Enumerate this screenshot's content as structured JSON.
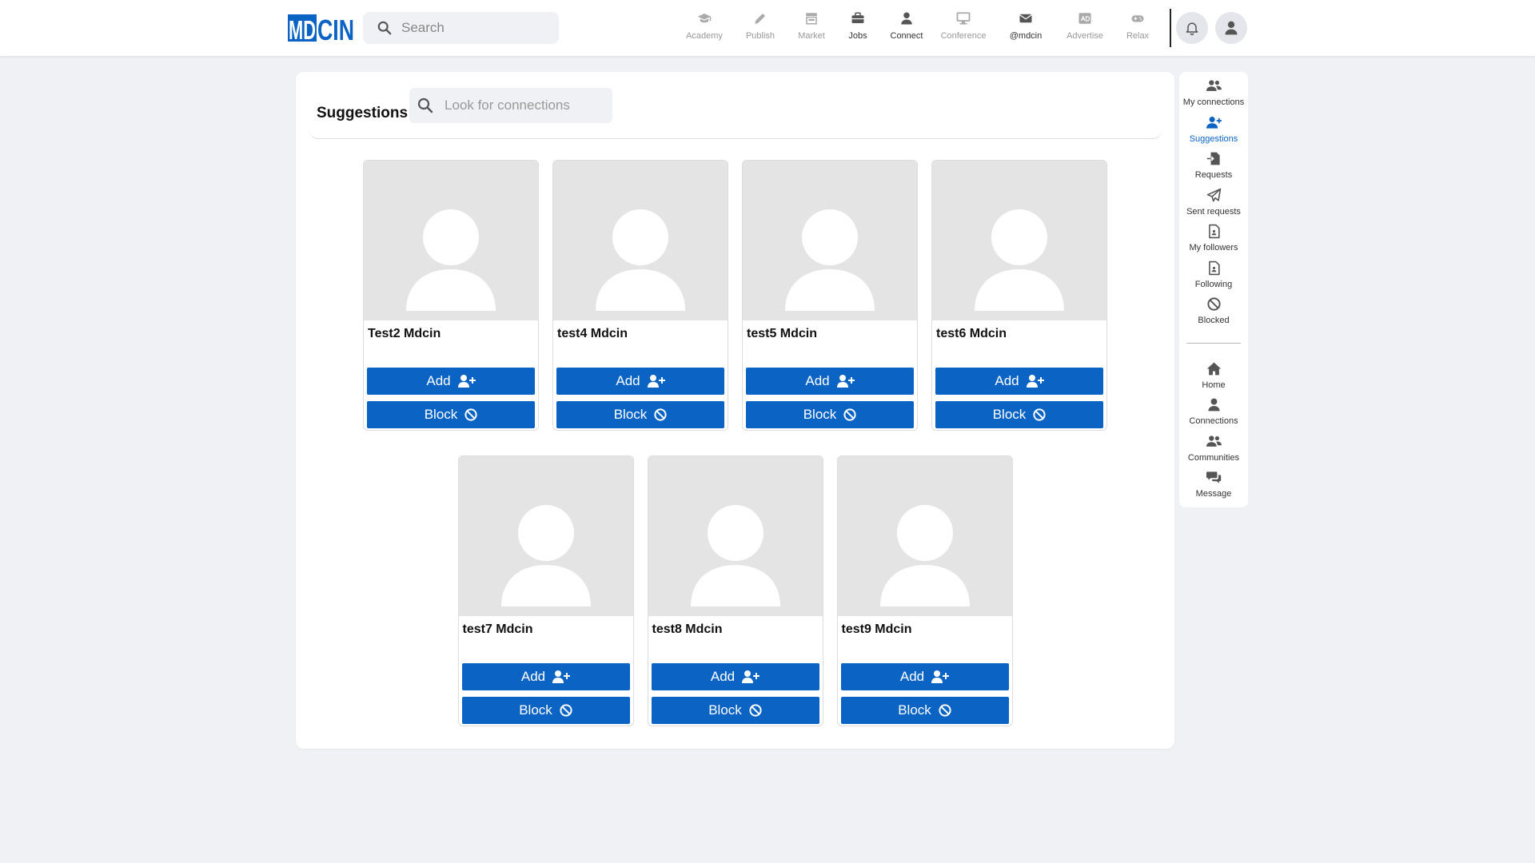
{
  "app": {
    "logo_text": "MDCIN"
  },
  "colors": {
    "primary": "#0b64c4",
    "background": "#f0f1f5",
    "placeholder_photo": "#e4e4e4"
  },
  "top_search": {
    "placeholder": "Search",
    "icon": "search-icon"
  },
  "top_nav": [
    {
      "label": "Academy",
      "icon": "graduation-cap-icon"
    },
    {
      "label": "Publish",
      "icon": "pencil-icon"
    },
    {
      "label": "Market",
      "icon": "store-icon"
    },
    {
      "label": "Jobs",
      "icon": "briefcase-icon"
    },
    {
      "label": "Connect",
      "icon": "user-icon"
    },
    {
      "label": "Conference",
      "icon": "monitor-icon"
    },
    {
      "label": "@mdcin",
      "icon": "envelope-icon"
    },
    {
      "label": "Advertise",
      "icon": "ad-icon"
    },
    {
      "label": "Relax",
      "icon": "gamepad-icon"
    }
  ],
  "header_actions": {
    "notifications_icon": "bell-icon",
    "profile_icon": "user-avatar-icon"
  },
  "main": {
    "title": "Suggestions",
    "search_placeholder": "Look for connections"
  },
  "suggestions": [
    {
      "name": "Test2 Mdcin",
      "add_label": "Add",
      "block_label": "Block"
    },
    {
      "name": "test4 Mdcin",
      "add_label": "Add",
      "block_label": "Block"
    },
    {
      "name": "test5 Mdcin",
      "add_label": "Add",
      "block_label": "Block"
    },
    {
      "name": "test6 Mdcin",
      "add_label": "Add",
      "block_label": "Block"
    },
    {
      "name": "test7 Mdcin",
      "add_label": "Add",
      "block_label": "Block"
    },
    {
      "name": "test8 Mdcin",
      "add_label": "Add",
      "block_label": "Block"
    },
    {
      "name": "test9 Mdcin",
      "add_label": "Add",
      "block_label": "Block"
    }
  ],
  "sidebar": {
    "connect_items": [
      {
        "label": "My connections",
        "icon": "users-icon"
      },
      {
        "label": "Suggestions",
        "icon": "user-plus-icon",
        "active": true
      },
      {
        "label": "Requests",
        "icon": "file-import-icon"
      },
      {
        "label": "Sent requests",
        "icon": "paper-plane-icon"
      },
      {
        "label": "My followers",
        "icon": "file-user-icon"
      },
      {
        "label": "Following",
        "icon": "file-user-icon"
      },
      {
        "label": "Blocked",
        "icon": "ban-icon"
      }
    ],
    "general_items": [
      {
        "label": "Home",
        "icon": "home-icon"
      },
      {
        "label": "Connections",
        "icon": "user-icon"
      },
      {
        "label": "Communities",
        "icon": "users-icon"
      },
      {
        "label": "Message",
        "icon": "comments-icon"
      }
    ]
  }
}
